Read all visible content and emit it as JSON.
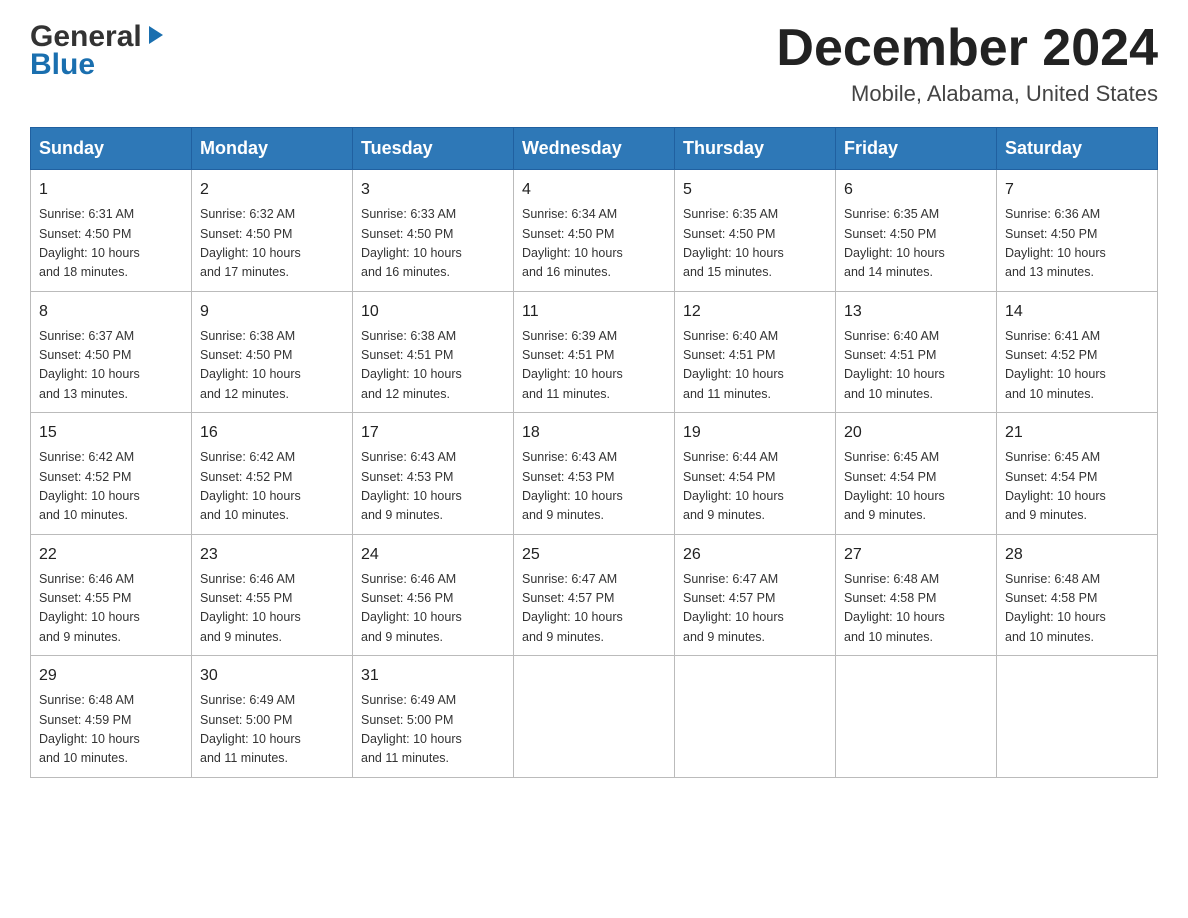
{
  "header": {
    "logo": {
      "general": "General",
      "blue": "Blue"
    },
    "title": "December 2024",
    "location": "Mobile, Alabama, United States"
  },
  "weekdays": [
    "Sunday",
    "Monday",
    "Tuesday",
    "Wednesday",
    "Thursday",
    "Friday",
    "Saturday"
  ],
  "weeks": [
    [
      {
        "day": "1",
        "sunrise": "6:31 AM",
        "sunset": "4:50 PM",
        "daylight": "10 hours and 18 minutes."
      },
      {
        "day": "2",
        "sunrise": "6:32 AM",
        "sunset": "4:50 PM",
        "daylight": "10 hours and 17 minutes."
      },
      {
        "day": "3",
        "sunrise": "6:33 AM",
        "sunset": "4:50 PM",
        "daylight": "10 hours and 16 minutes."
      },
      {
        "day": "4",
        "sunrise": "6:34 AM",
        "sunset": "4:50 PM",
        "daylight": "10 hours and 16 minutes."
      },
      {
        "day": "5",
        "sunrise": "6:35 AM",
        "sunset": "4:50 PM",
        "daylight": "10 hours and 15 minutes."
      },
      {
        "day": "6",
        "sunrise": "6:35 AM",
        "sunset": "4:50 PM",
        "daylight": "10 hours and 14 minutes."
      },
      {
        "day": "7",
        "sunrise": "6:36 AM",
        "sunset": "4:50 PM",
        "daylight": "10 hours and 13 minutes."
      }
    ],
    [
      {
        "day": "8",
        "sunrise": "6:37 AM",
        "sunset": "4:50 PM",
        "daylight": "10 hours and 13 minutes."
      },
      {
        "day": "9",
        "sunrise": "6:38 AM",
        "sunset": "4:50 PM",
        "daylight": "10 hours and 12 minutes."
      },
      {
        "day": "10",
        "sunrise": "6:38 AM",
        "sunset": "4:51 PM",
        "daylight": "10 hours and 12 minutes."
      },
      {
        "day": "11",
        "sunrise": "6:39 AM",
        "sunset": "4:51 PM",
        "daylight": "10 hours and 11 minutes."
      },
      {
        "day": "12",
        "sunrise": "6:40 AM",
        "sunset": "4:51 PM",
        "daylight": "10 hours and 11 minutes."
      },
      {
        "day": "13",
        "sunrise": "6:40 AM",
        "sunset": "4:51 PM",
        "daylight": "10 hours and 10 minutes."
      },
      {
        "day": "14",
        "sunrise": "6:41 AM",
        "sunset": "4:52 PM",
        "daylight": "10 hours and 10 minutes."
      }
    ],
    [
      {
        "day": "15",
        "sunrise": "6:42 AM",
        "sunset": "4:52 PM",
        "daylight": "10 hours and 10 minutes."
      },
      {
        "day": "16",
        "sunrise": "6:42 AM",
        "sunset": "4:52 PM",
        "daylight": "10 hours and 10 minutes."
      },
      {
        "day": "17",
        "sunrise": "6:43 AM",
        "sunset": "4:53 PM",
        "daylight": "10 hours and 9 minutes."
      },
      {
        "day": "18",
        "sunrise": "6:43 AM",
        "sunset": "4:53 PM",
        "daylight": "10 hours and 9 minutes."
      },
      {
        "day": "19",
        "sunrise": "6:44 AM",
        "sunset": "4:54 PM",
        "daylight": "10 hours and 9 minutes."
      },
      {
        "day": "20",
        "sunrise": "6:45 AM",
        "sunset": "4:54 PM",
        "daylight": "10 hours and 9 minutes."
      },
      {
        "day": "21",
        "sunrise": "6:45 AM",
        "sunset": "4:54 PM",
        "daylight": "10 hours and 9 minutes."
      }
    ],
    [
      {
        "day": "22",
        "sunrise": "6:46 AM",
        "sunset": "4:55 PM",
        "daylight": "10 hours and 9 minutes."
      },
      {
        "day": "23",
        "sunrise": "6:46 AM",
        "sunset": "4:55 PM",
        "daylight": "10 hours and 9 minutes."
      },
      {
        "day": "24",
        "sunrise": "6:46 AM",
        "sunset": "4:56 PM",
        "daylight": "10 hours and 9 minutes."
      },
      {
        "day": "25",
        "sunrise": "6:47 AM",
        "sunset": "4:57 PM",
        "daylight": "10 hours and 9 minutes."
      },
      {
        "day": "26",
        "sunrise": "6:47 AM",
        "sunset": "4:57 PM",
        "daylight": "10 hours and 9 minutes."
      },
      {
        "day": "27",
        "sunrise": "6:48 AM",
        "sunset": "4:58 PM",
        "daylight": "10 hours and 10 minutes."
      },
      {
        "day": "28",
        "sunrise": "6:48 AM",
        "sunset": "4:58 PM",
        "daylight": "10 hours and 10 minutes."
      }
    ],
    [
      {
        "day": "29",
        "sunrise": "6:48 AM",
        "sunset": "4:59 PM",
        "daylight": "10 hours and 10 minutes."
      },
      {
        "day": "30",
        "sunrise": "6:49 AM",
        "sunset": "5:00 PM",
        "daylight": "10 hours and 11 minutes."
      },
      {
        "day": "31",
        "sunrise": "6:49 AM",
        "sunset": "5:00 PM",
        "daylight": "10 hours and 11 minutes."
      },
      null,
      null,
      null,
      null
    ]
  ],
  "labels": {
    "sunrise": "Sunrise:",
    "sunset": "Sunset:",
    "daylight": "Daylight:"
  }
}
